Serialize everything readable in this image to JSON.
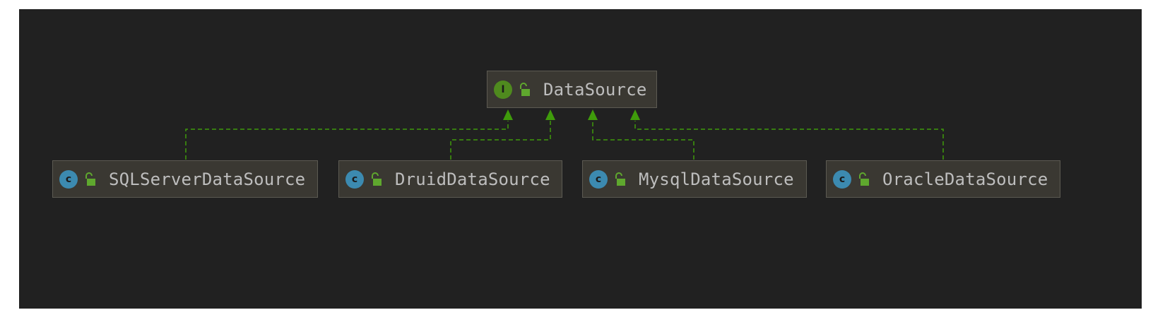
{
  "diagram": {
    "interface_node": {
      "name": "DataSource",
      "type_icon": "interface-icon",
      "type_letter": "I",
      "visibility_icon": "public-lock-icon"
    },
    "class_nodes": [
      {
        "name": "SQLServerDataSource",
        "type_icon": "class-icon",
        "type_letter": "c",
        "visibility_icon": "public-lock-icon"
      },
      {
        "name": "DruidDataSource",
        "type_icon": "class-icon",
        "type_letter": "c",
        "visibility_icon": "public-lock-icon"
      },
      {
        "name": "MysqlDataSource",
        "type_icon": "class-icon",
        "type_letter": "c",
        "visibility_icon": "public-lock-icon"
      },
      {
        "name": "OracleDataSource",
        "type_icon": "class-icon",
        "type_letter": "c",
        "visibility_icon": "public-lock-icon"
      }
    ],
    "relationships": [
      {
        "from": "SQLServerDataSource",
        "to": "DataSource",
        "kind": "implements"
      },
      {
        "from": "DruidDataSource",
        "to": "DataSource",
        "kind": "implements"
      },
      {
        "from": "MysqlDataSource",
        "to": "DataSource",
        "kind": "implements"
      },
      {
        "from": "OracleDataSource",
        "to": "DataSource",
        "kind": "implements"
      }
    ],
    "colors": {
      "background": "#212121",
      "node_fill": "#3a3832",
      "node_border": "#5c5a52",
      "text": "#bdbdbd",
      "edge": "#3f9b0b",
      "interface_badge": "#4f8a1e",
      "class_badge": "#3c8ab0",
      "lock": "#5fa82e"
    }
  }
}
